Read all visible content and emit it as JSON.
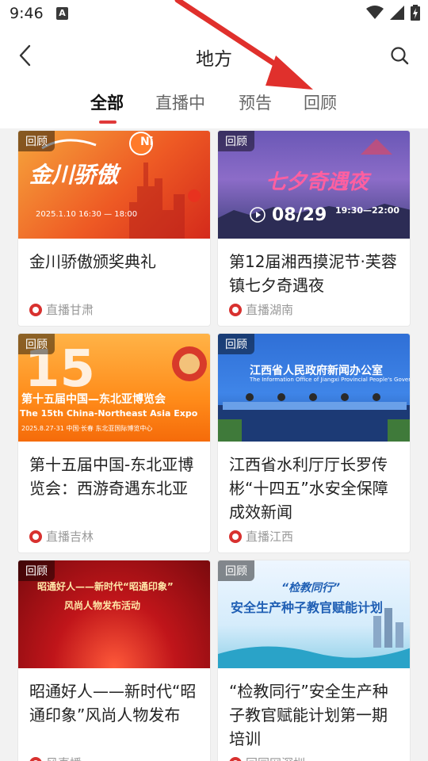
{
  "status": {
    "time": "9:46",
    "indicator": "A"
  },
  "header": {
    "title": "地方",
    "back_icon": "chevron-left-icon",
    "search_icon": "search-icon"
  },
  "tabs": [
    {
      "label": "全部",
      "active": true
    },
    {
      "label": "直播中",
      "active": false
    },
    {
      "label": "预告",
      "active": false
    },
    {
      "label": "回顾",
      "active": false
    }
  ],
  "accent_color": "#e03a3a",
  "cards": [
    {
      "badge": "回顾",
      "title": "金川骄傲颁奖典礼",
      "source": "直播甘肃",
      "thumb_text": "金川骄傲",
      "thumb_sub": "2025.1.10 16:30 — 18:00",
      "thumb_corner": "Ni"
    },
    {
      "badge": "回顾",
      "title": "第12届湘西摸泥节·芙蓉镇七夕奇遇夜",
      "source": "直播湖南",
      "thumb_text": "七夕奇遇夜",
      "thumb_sub": "08/29",
      "thumb_time": "19:30—22:00"
    },
    {
      "badge": "回顾",
      "title": "第十五届中国-东北亚博览会：西游奇遇东北亚",
      "source": "直播吉林",
      "thumb_text": "第十五届中国—东北亚博览会",
      "thumb_sub": "The 15th China-Northeast Asia Expo",
      "thumb_date": "2025.8.27-31  中国·长春  东北亚国际博览中心"
    },
    {
      "badge": "回顾",
      "title": "江西省水利厅厅长罗传彬“十四五”水安全保障成效新闻",
      "source": "直播江西",
      "thumb_text": "江西省人民政府新闻办公室",
      "thumb_sub": "The Information Office of Jiangxi Provincial People's Government"
    },
    {
      "badge": "回顾",
      "title": "昭通好人——新时代“昭通印象”风尚人物发布",
      "source": "风直播",
      "thumb_text": "昭通好人——新时代“昭通印象”",
      "thumb_sub": "风尚人物发布活动"
    },
    {
      "badge": "回顾",
      "title": "“检教同行”安全生产种子教官赋能计划第一期培训",
      "source": "回园网深圳",
      "thumb_text": "“检教同行”",
      "thumb_sub": "安全生产种子教官赋能计划"
    }
  ]
}
